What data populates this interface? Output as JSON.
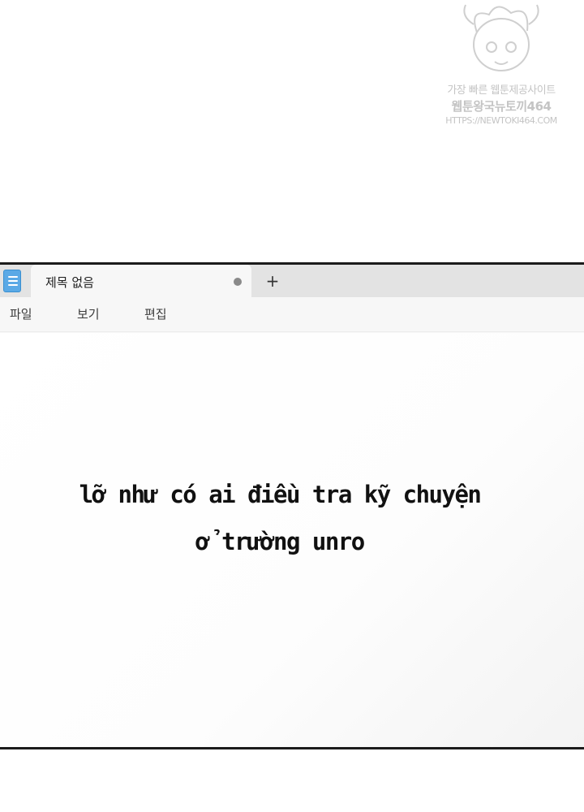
{
  "watermark": {
    "line1": "가장 빠른 웹툰제공사이트",
    "line2": "웹툰왕국뉴토끼464",
    "line3": "HTTPS://NEWTOKI464.COM"
  },
  "window": {
    "app_icon": "notepad-icon",
    "tab_title": "제목 없음",
    "tab_status_icon": "unsaved-dot-icon",
    "new_tab_label": "+",
    "menu": {
      "file": "파일",
      "view": "보기",
      "edit": "편집"
    },
    "editor_lines": [
      "lỡ như có ai điều tra kỹ chuyện",
      "ở trường unro"
    ],
    "colors": {
      "icon_accent": "#5aa9e6",
      "tab_strip": "#e3e3e3",
      "window_border": "#1b1b1b"
    }
  }
}
